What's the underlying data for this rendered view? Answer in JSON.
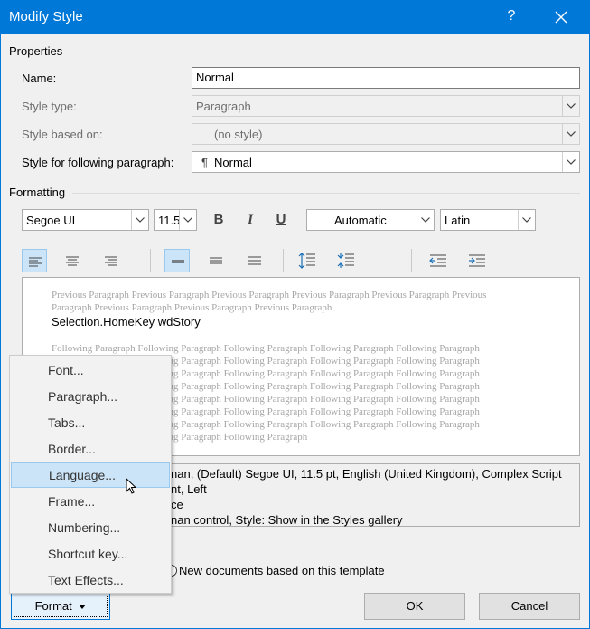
{
  "window": {
    "title": "Modify Style",
    "help": "?",
    "close": "✕"
  },
  "properties": {
    "heading": "Properties",
    "name_label": "Name:",
    "name_value": "Normal",
    "style_type_label": "Style type:",
    "style_type_value": "Paragraph",
    "based_on_label": "Style based on:",
    "based_on_value": "(no style)",
    "following_label": "Style for following paragraph:",
    "following_mark": "¶",
    "following_value": "Normal"
  },
  "formatting": {
    "heading": "Formatting",
    "font": "Segoe UI",
    "size": "11.5",
    "bold": "B",
    "italic": "I",
    "underline": "U",
    "color": "Automatic",
    "script": "Latin"
  },
  "preview": {
    "previous": "Previous Paragraph Previous Paragraph Previous Paragraph Previous Paragraph Previous Paragraph Previous Paragraph Previous Paragraph Previous Paragraph Previous Paragraph",
    "sample": "Selection.HomeKey wdStory",
    "following_lines": [
      "Following Paragraph Following Paragraph Following Paragraph Following Paragraph Following Paragraph",
      "Following Paragraph Following Paragraph Following Paragraph Following Paragraph Following Paragraph",
      "Following Paragraph Following Paragraph Following Paragraph Following Paragraph Following Paragraph",
      "Following Paragraph Following Paragraph Following Paragraph Following Paragraph Following Paragraph",
      "Following Paragraph Following Paragraph Following Paragraph Following Paragraph Following Paragraph",
      "Following Paragraph Following Paragraph Following Paragraph Following Paragraph Following Paragraph",
      "Following Paragraph Following Paragraph Following Paragraph Following Paragraph Following Paragraph",
      "Following Paragraph Following Paragraph Following Paragraph"
    ]
  },
  "description": {
    "line1": "nan, (Default) Segoe UI, 11.5 pt, English (United Kingdom), Complex Script",
    "line2": "nt, Left",
    "line3": "ce",
    "line4": "nan control, Style: Show in the Styles gallery"
  },
  "bottom": {
    "new_docs_label": "New documents based on this template",
    "format_label": "Format",
    "ok_label": "OK",
    "cancel_label": "Cancel"
  },
  "menu": {
    "items": [
      "Font...",
      "Paragraph...",
      "Tabs...",
      "Border...",
      "Language...",
      "Frame...",
      "Numbering...",
      "Shortcut key...",
      "Text Effects..."
    ],
    "highlighted": "Language..."
  }
}
